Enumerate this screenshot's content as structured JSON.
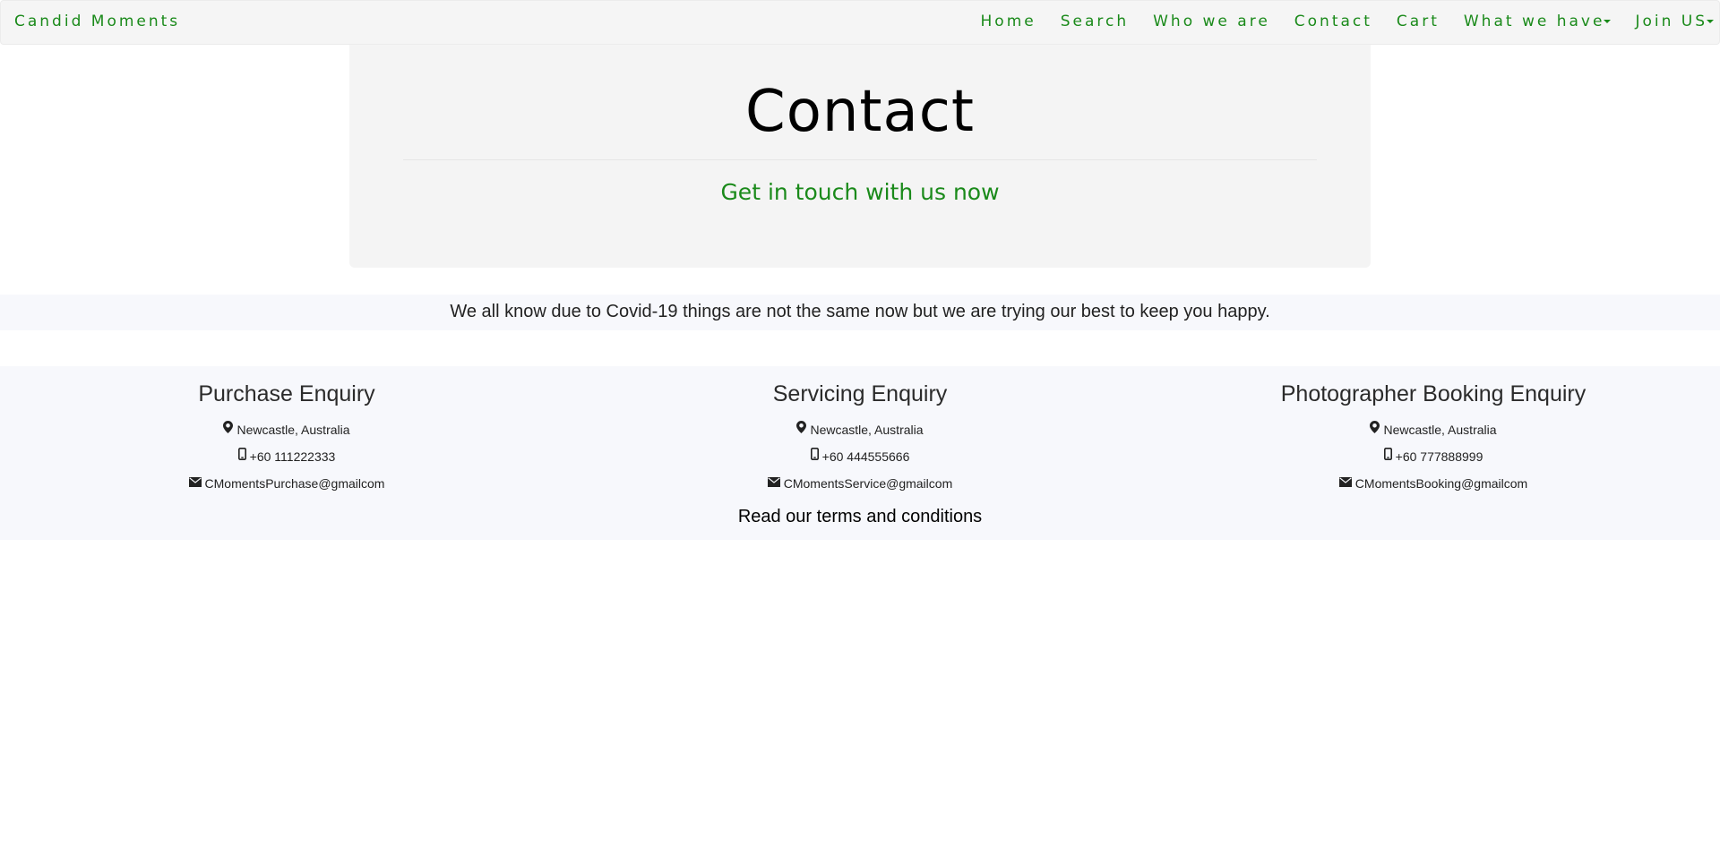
{
  "navbar": {
    "brand": "Candid Moments",
    "items": [
      {
        "label": "Home"
      },
      {
        "label": "Search"
      },
      {
        "label": "Who we are"
      },
      {
        "label": "Contact"
      },
      {
        "label": "Cart"
      },
      {
        "label": "What we have"
      },
      {
        "label": "Join US"
      }
    ]
  },
  "jumbotron": {
    "title": "Contact",
    "subtitle": "Get in touch with us now"
  },
  "notice": "We all know due to Covid-19 things are not the same now but we are trying our best to keep you happy.",
  "enquiries": [
    {
      "title": "Purchase Enquiry",
      "location": "Newcastle, Australia",
      "phone": "+60 111222333",
      "email": "CMomentsPurchase@gmailcom"
    },
    {
      "title": "Servicing Enquiry",
      "location": "Newcastle, Australia",
      "phone": "+60 444555666",
      "email": "CMomentsService@gmailcom"
    },
    {
      "title": "Photographer Booking Enquiry",
      "location": "Newcastle, Australia",
      "phone": "+60 777888999",
      "email": "CMomentsBooking@gmailcom"
    }
  ],
  "footer": {
    "terms_link": "Read our terms and conditions"
  },
  "colors": {
    "accent_green": "#1a8a1a",
    "navbar_bg": "#f5f5f5",
    "band_bg": "#f7f8fc"
  },
  "icons": {
    "location": "map-marker-icon",
    "phone": "mobile-phone-icon",
    "email": "envelope-icon",
    "dropdown": "caret-down-icon"
  }
}
